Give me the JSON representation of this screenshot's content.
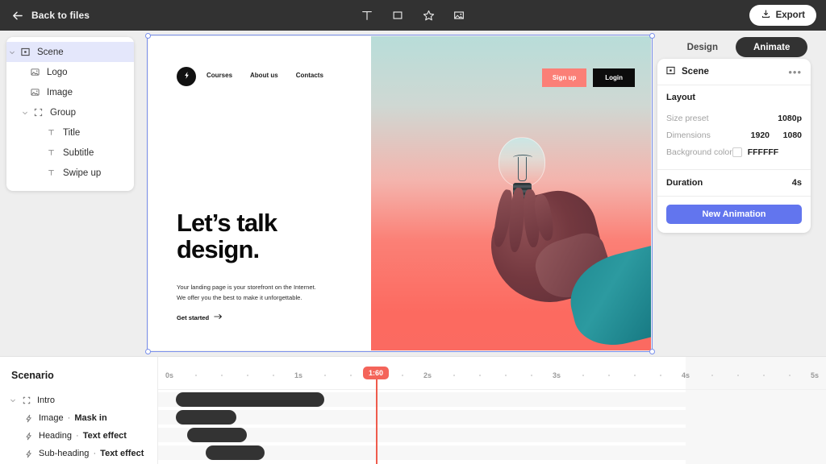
{
  "topbar": {
    "back_label": "Back to files",
    "back_icon": "arrow-left-icon",
    "tools": [
      {
        "name": "text-tool",
        "icon": "text-T-icon"
      },
      {
        "name": "rectangle-tool",
        "icon": "square-icon"
      },
      {
        "name": "star-tool",
        "icon": "star-icon"
      },
      {
        "name": "image-tool",
        "icon": "image-icon"
      }
    ],
    "export_label": "Export",
    "export_icon": "download-icon"
  },
  "layers": {
    "items": [
      {
        "label": "Scene",
        "icon": "frame-icon",
        "depth": 0,
        "caret": "chevron-down",
        "selected": true
      },
      {
        "label": "Logo",
        "icon": "image-icon",
        "depth": 1,
        "caret": "",
        "selected": false
      },
      {
        "label": "Image",
        "icon": "image-icon",
        "depth": 1,
        "caret": "",
        "selected": false
      },
      {
        "label": "Group",
        "icon": "group-icon",
        "depth": 1,
        "caret": "chevron-down",
        "selected": false
      },
      {
        "label": "Title",
        "icon": "text-icon",
        "depth": 2,
        "caret": "",
        "selected": false
      },
      {
        "label": "Subtitle",
        "icon": "text-icon",
        "depth": 2,
        "caret": "",
        "selected": false
      },
      {
        "label": "Swipe up",
        "icon": "text-icon",
        "depth": 2,
        "caret": "",
        "selected": false
      }
    ]
  },
  "artboard": {
    "logo_icon": "lightning-bolt-icon",
    "nav": [
      "Courses",
      "About us",
      "Contacts"
    ],
    "signup_label": "Sign up",
    "login_label": "Login",
    "heading_line1": "Let’s talk",
    "heading_line2": "design.",
    "paragraph_line1": "Your landing page is your storefront on the Internet.",
    "paragraph_line2": "We offer you the best to make it unforgettable.",
    "cta_label": "Get started",
    "cta_icon": "arrow-right-icon",
    "photo_alt": "hand holding a lightbulb against teal to coral gradient sky"
  },
  "inspector": {
    "tabs": [
      {
        "label": "Design",
        "active": false
      },
      {
        "label": "Animate",
        "active": true
      }
    ],
    "card_title": "Scene",
    "card_icon": "frame-icon",
    "menu_icon": "ellipsis-icon",
    "layout_title": "Layout",
    "properties": [
      {
        "key": "Size preset",
        "value": "1080p"
      },
      {
        "key": "Dimensions",
        "value": "1920",
        "value2": "1080"
      },
      {
        "key": "Background color",
        "value": "FFFFFF",
        "swatch": "#FFFFFF"
      }
    ],
    "duration_key": "Duration",
    "duration_value": "4s",
    "new_animation_label": "New Animation",
    "accent_color": "#6275ee"
  },
  "timeline": {
    "panel_title": "Scenario",
    "group": {
      "label": "Intro",
      "icon": "group-icon",
      "caret": "chevron-down"
    },
    "rows": [
      {
        "layer": "Image",
        "effect": "Mask in",
        "icon": "bolt-icon"
      },
      {
        "layer": "Heading",
        "effect": "Text effect",
        "icon": "bolt-icon"
      },
      {
        "layer": "Sub-heading",
        "effect": "Text effect",
        "icon": "bolt-icon"
      }
    ],
    "ruler": {
      "labels": [
        "0s",
        "1s",
        "2s",
        "3s",
        "4s",
        "5s"
      ],
      "seconds": [
        0,
        1,
        2,
        3,
        4,
        5
      ],
      "subdivisions_per_second": 5
    },
    "playhead": {
      "label": "1:60",
      "time_seconds": 1.6,
      "color": "#f4645a"
    },
    "bars": [
      {
        "name": "intro-group-bar",
        "start_seconds": 0.05,
        "end_seconds": 1.2
      },
      {
        "name": "image-mask-in-bar",
        "start_seconds": 0.05,
        "end_seconds": 0.52
      },
      {
        "name": "heading-text-effect-bar",
        "start_seconds": 0.14,
        "end_seconds": 0.6
      },
      {
        "name": "sub-heading-text-effect-bar",
        "start_seconds": 0.28,
        "end_seconds": 0.74
      }
    ],
    "bar_color": "#333333"
  }
}
